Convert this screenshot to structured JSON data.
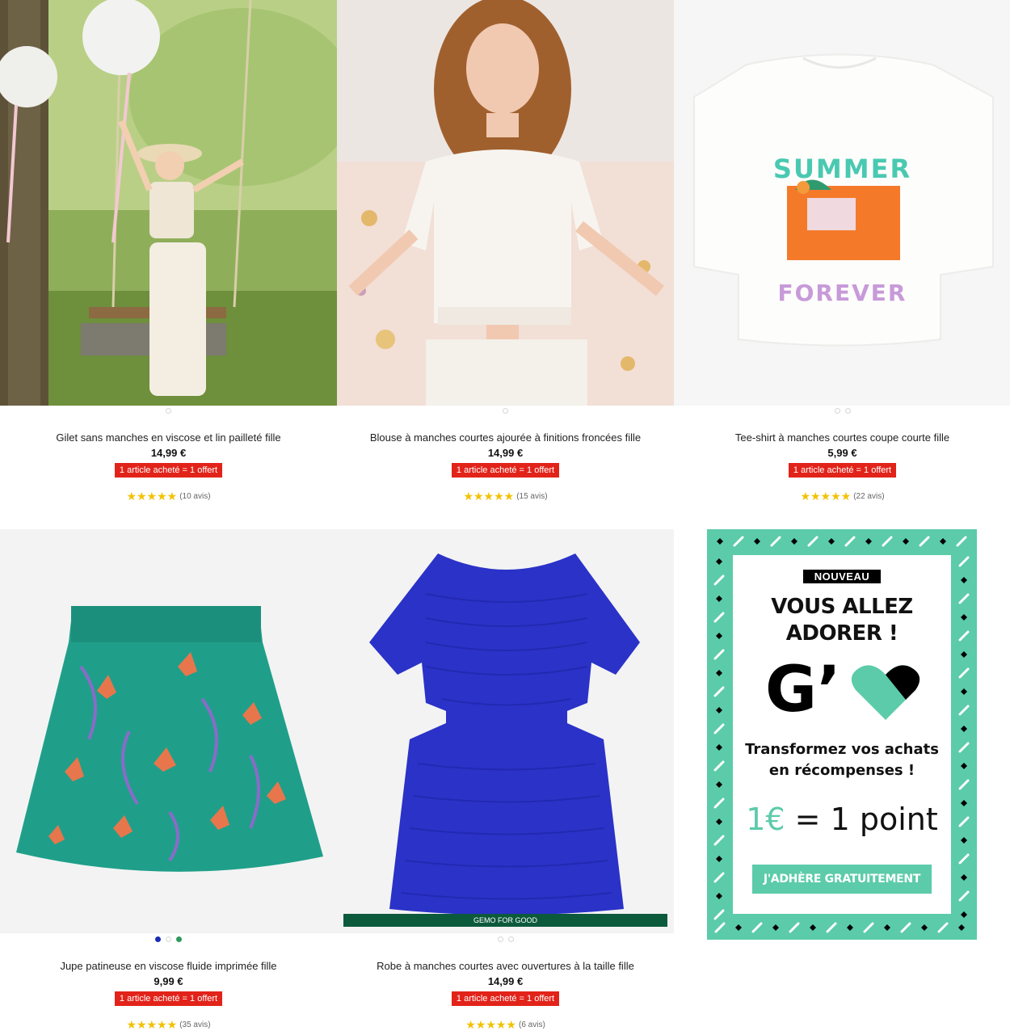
{
  "products": [
    {
      "title": "Gilet sans manches en viscose et lin pailleté fille",
      "price": "14,99 €",
      "promo": "1 article acheté = 1 offert",
      "stars": "★★★★★",
      "rating": 4.5,
      "reviews": "(10 avis)",
      "colors": [
        "#ffffff"
      ]
    },
    {
      "title": "Blouse à manches courtes ajourée à finitions froncées fille",
      "price": "14,99 €",
      "promo": "1 article acheté = 1 offert",
      "stars": "★★★★★",
      "rating": 4.5,
      "reviews": "(15 avis)",
      "colors": [
        "#ffffff"
      ]
    },
    {
      "title": "Tee-shirt à manches courtes coupe courte fille",
      "price": "5,99 €",
      "promo": "1 article acheté = 1 offert",
      "stars": "★★★★★",
      "rating": 5,
      "reviews": "(22 avis)",
      "colors": [
        "#ffffff",
        "#ffffff"
      ],
      "print_top": "SUMMER",
      "print_bottom": "FOREVER"
    },
    {
      "title": "Jupe patineuse en viscose fluide imprimée fille",
      "price": "9,99 €",
      "promo": "1 article acheté = 1 offert",
      "stars": "★★★★★",
      "rating": 5,
      "reviews": "(35 avis)",
      "colors": [
        "#1a2bb5",
        "#ffffff",
        "#2e9a5e"
      ]
    },
    {
      "title": "Robe à manches courtes avec ouvertures à la taille fille",
      "price": "14,99 €",
      "promo": "1 article acheté = 1 offert",
      "stars": "★★★★★",
      "rating": 5,
      "reviews": "(6 avis)",
      "colors": [
        "#ffffff",
        "#ffffff"
      ],
      "badge": "GEMO FOR GOOD"
    }
  ],
  "banner": {
    "tag": "NOUVEAU",
    "headline_line1": "VOUS ALLEZ",
    "headline_line2": "ADORER !",
    "logo_letter": "G’",
    "sub_line1": "Transformez vos achats",
    "sub_line2": "en récompenses !",
    "points_eur": "1€",
    "points_rest": " = 1 point",
    "cta": "J'ADHÈRE GRATUITEMENT",
    "accent_color": "#5ccba9"
  }
}
